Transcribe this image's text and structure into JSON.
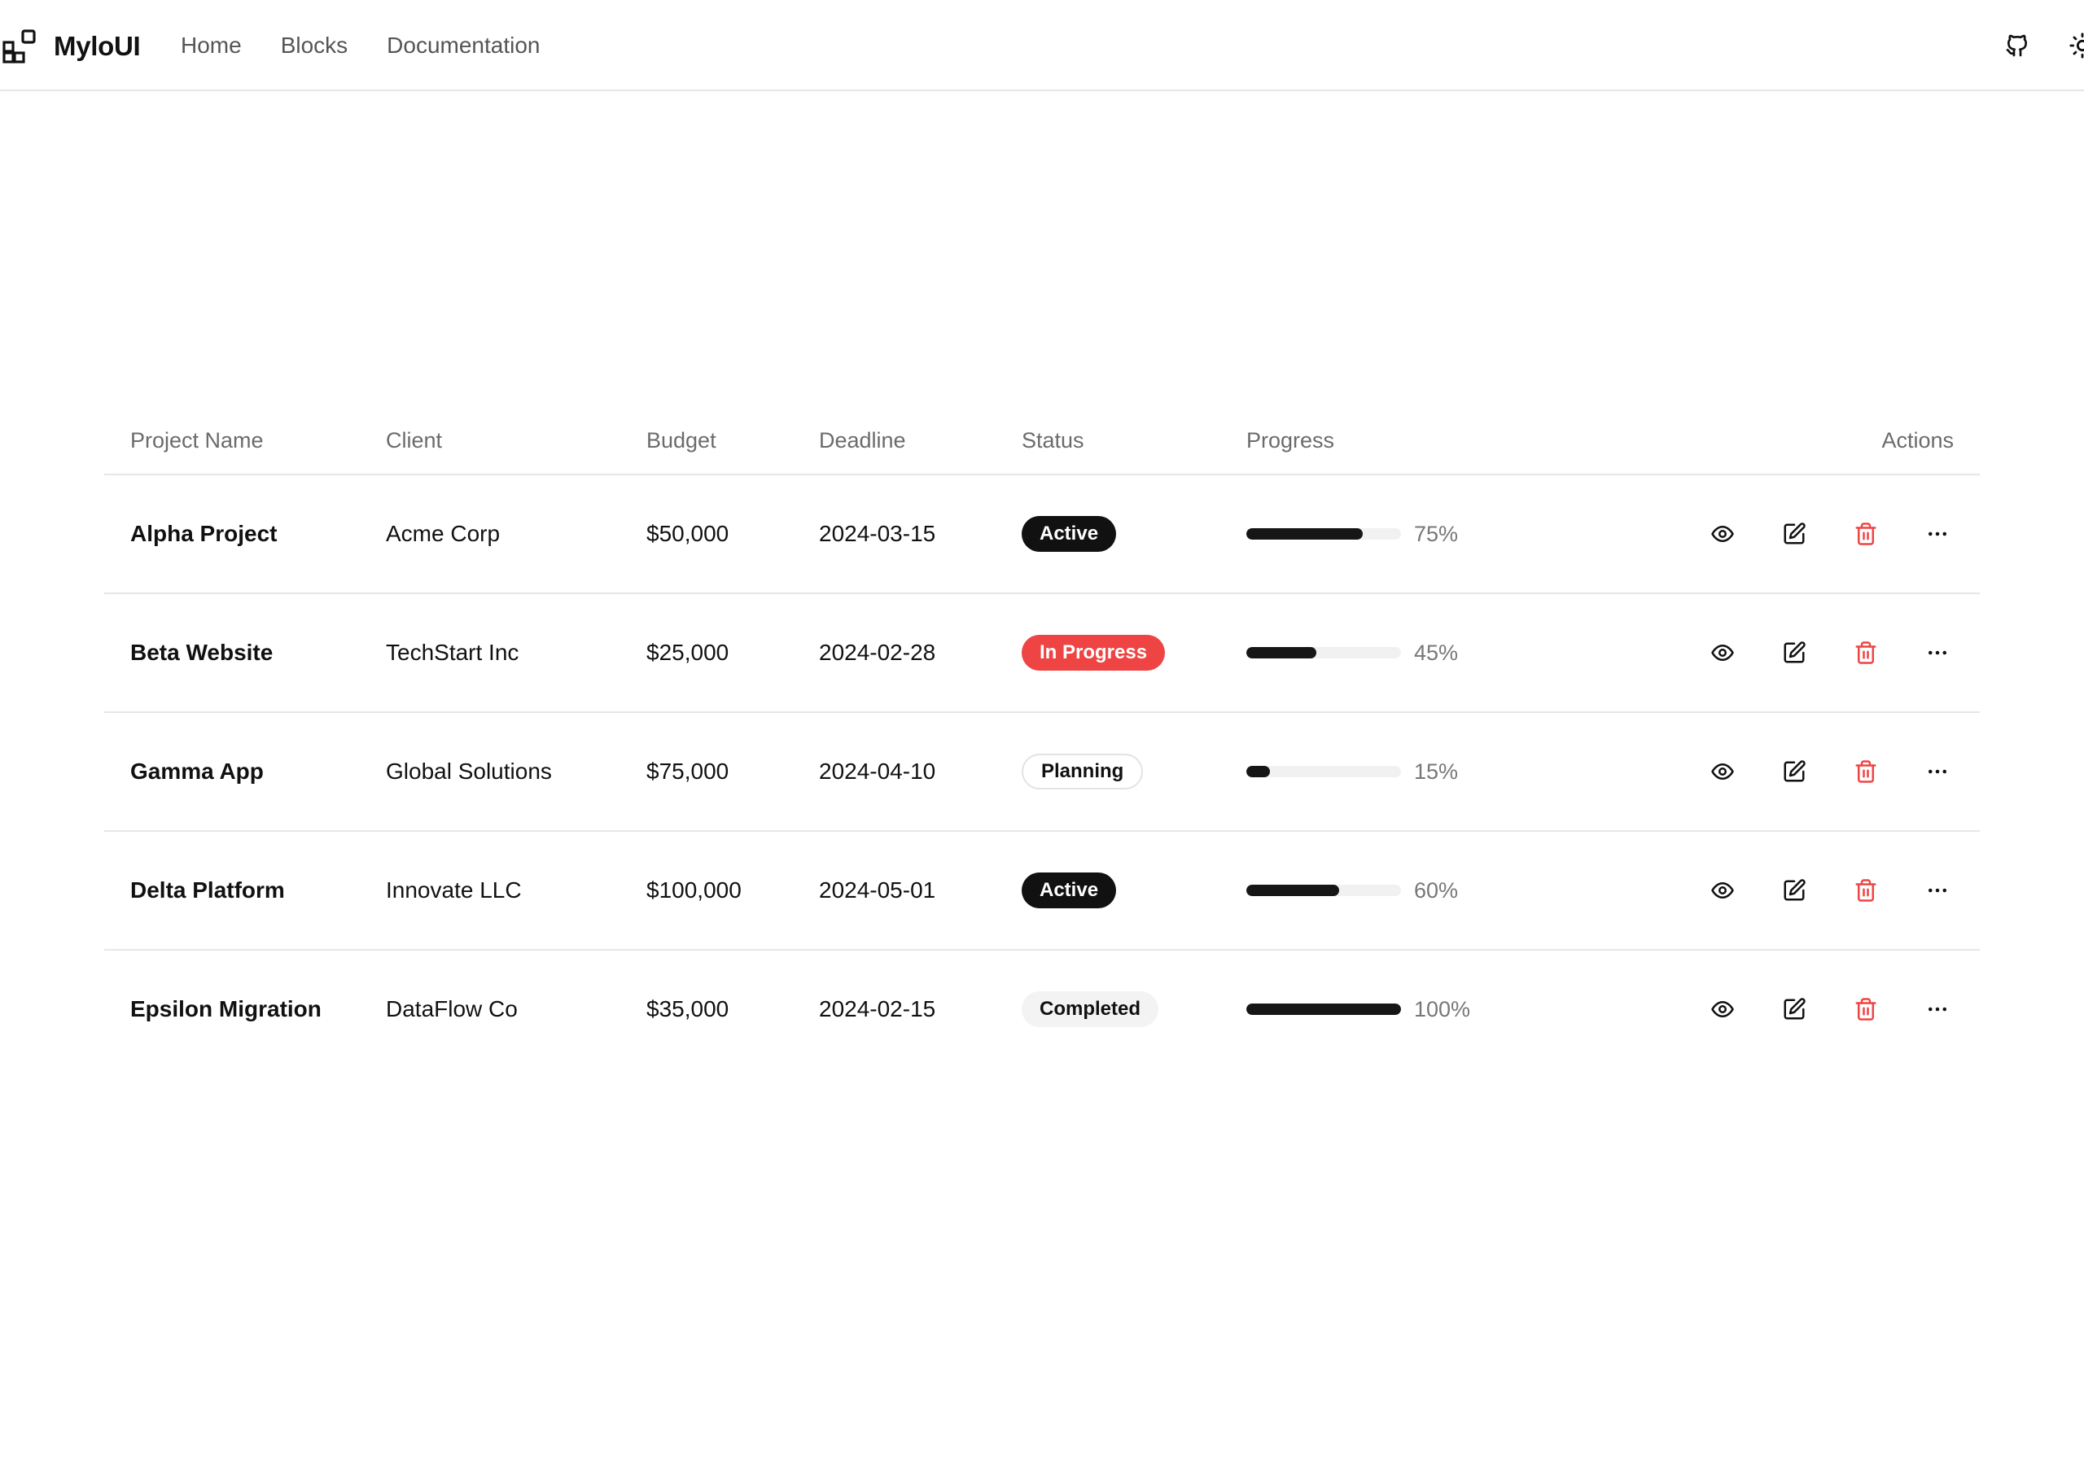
{
  "header": {
    "brand": "MyloUI",
    "nav": [
      {
        "label": "Home"
      },
      {
        "label": "Blocks"
      },
      {
        "label": "Documentation"
      }
    ],
    "icons": [
      "github-icon",
      "sun-icon"
    ]
  },
  "table": {
    "columns": {
      "name": "Project Name",
      "client": "Client",
      "budget": "Budget",
      "deadline": "Deadline",
      "status": "Status",
      "progress": "Progress",
      "actions": "Actions"
    },
    "rows": [
      {
        "name": "Alpha Project",
        "client": "Acme Corp",
        "budget": "$50,000",
        "deadline": "2024-03-15",
        "status": "Active",
        "status_style": "dark",
        "progress": 75,
        "progress_label": "75%"
      },
      {
        "name": "Beta Website",
        "client": "TechStart Inc",
        "budget": "$25,000",
        "deadline": "2024-02-28",
        "status": "In Progress",
        "status_style": "red",
        "progress": 45,
        "progress_label": "45%"
      },
      {
        "name": "Gamma App",
        "client": "Global Solutions",
        "budget": "$75,000",
        "deadline": "2024-04-10",
        "status": "Planning",
        "status_style": "outline",
        "progress": 15,
        "progress_label": "15%"
      },
      {
        "name": "Delta Platform",
        "client": "Innovate LLC",
        "budget": "$100,000",
        "deadline": "2024-05-01",
        "status": "Active",
        "status_style": "dark",
        "progress": 60,
        "progress_label": "60%"
      },
      {
        "name": "Epsilon Migration",
        "client": "DataFlow Co",
        "budget": "$35,000",
        "deadline": "2024-02-15",
        "status": "Completed",
        "status_style": "soft",
        "progress": 100,
        "progress_label": "100%"
      }
    ],
    "row_actions": [
      "eye-icon",
      "edit-icon",
      "trash-icon",
      "more-icon"
    ]
  },
  "colors": {
    "accent_dark": "#111111",
    "danger": "#ef4444",
    "muted_text": "#6b6b6b",
    "border": "#e6e6e6"
  }
}
